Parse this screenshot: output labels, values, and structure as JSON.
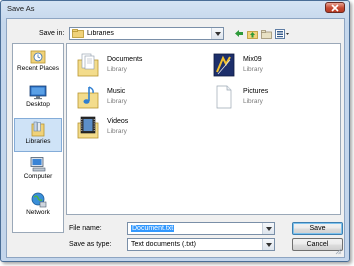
{
  "window": {
    "title": "Save As"
  },
  "toolbar": {
    "save_in_label": "Save in:",
    "save_in_value": "Libraries",
    "icons": [
      "back-icon",
      "up-folder-icon",
      "new-folder-icon",
      "views-menu-icon"
    ]
  },
  "places": [
    {
      "label": "Recent Places",
      "icon": "recent-places-icon"
    },
    {
      "label": "Desktop",
      "icon": "desktop-icon"
    },
    {
      "label": "Libraries",
      "icon": "libraries-icon",
      "selected": true
    },
    {
      "label": "Computer",
      "icon": "computer-icon"
    },
    {
      "label": "Network",
      "icon": "network-icon"
    }
  ],
  "files": [
    {
      "name": "Documents",
      "type": "Library",
      "icon": "documents-library-icon"
    },
    {
      "name": "Mix09",
      "type": "Library",
      "icon": "mix09-library-icon"
    },
    {
      "name": "Music",
      "type": "Library",
      "icon": "music-library-icon"
    },
    {
      "name": "Pictures",
      "type": "Library",
      "icon": "pictures-library-icon"
    },
    {
      "name": "Videos",
      "type": "Library",
      "icon": "videos-library-icon"
    }
  ],
  "footer": {
    "file_name_label": "File name:",
    "file_name_value": "Document.txt",
    "save_type_label": "Save as type:",
    "save_type_value": "Text documents (.txt)",
    "save_label": "Save",
    "cancel_label": "Cancel"
  },
  "colors": {
    "selection": "#3399ff",
    "selected_place": "#cfe3f7",
    "close_button": "#c74a32"
  }
}
